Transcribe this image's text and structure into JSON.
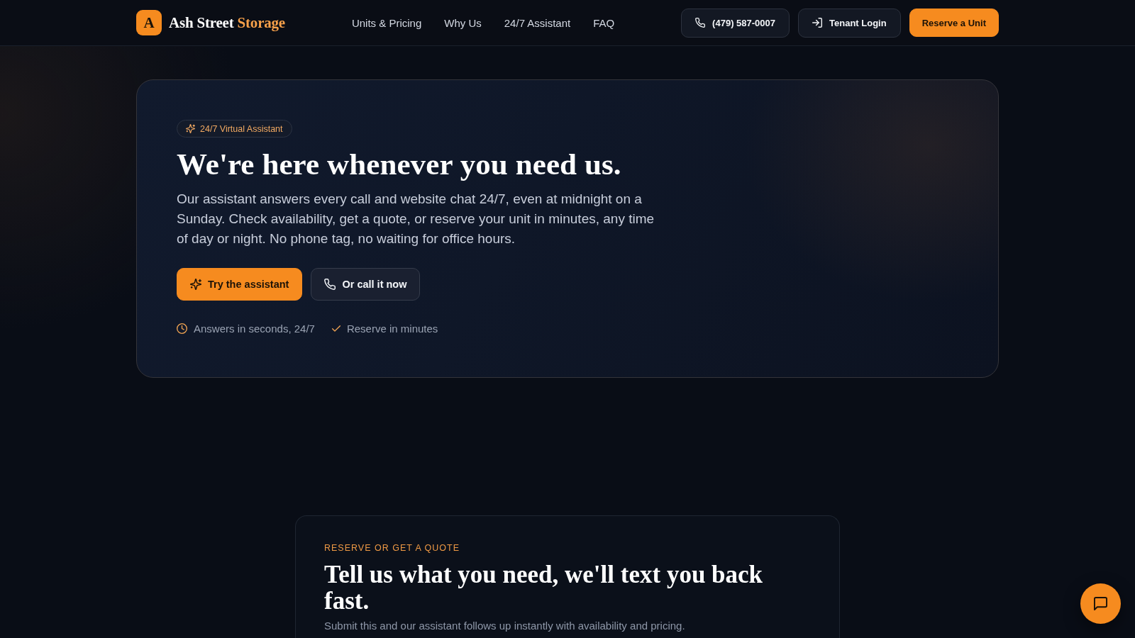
{
  "header": {
    "logo": {
      "mark": "A",
      "name": "Ash Street",
      "accent": "Storage"
    },
    "nav": [
      {
        "label": "Units & Pricing"
      },
      {
        "label": "Why Us"
      },
      {
        "label": "24/7 Assistant"
      },
      {
        "label": "FAQ"
      }
    ],
    "actions": [
      {
        "kind": "call",
        "label": "(479) 587-0007"
      },
      {
        "kind": "login",
        "label": "Tenant Login"
      },
      {
        "kind": "reserve",
        "label": "Reserve a Unit"
      }
    ]
  },
  "hero": {
    "badge": "24/7 Virtual Assistant",
    "title": "We're here whenever you need us.",
    "description": "Our assistant answers every call and website chat 24/7, even at midnight on a Sunday. Check availability, get a quote, or reserve your unit in minutes, any time of day or night. No phone tag, no waiting for office hours.",
    "buttons": [
      {
        "kind": "assistant",
        "label": "Try the assistant"
      },
      {
        "kind": "call",
        "label": "Or call it now"
      }
    ],
    "highlights": [
      {
        "kind": "time",
        "text": "Answers in seconds, 24/7"
      },
      {
        "kind": "check",
        "text": "Reserve in minutes"
      }
    ]
  },
  "quote": {
    "eyebrow": "RESERVE OR GET A QUOTE",
    "title": "Tell us what you need, we'll text you back fast.",
    "subtitle": "Submit this and our assistant follows up instantly with availability and pricing."
  },
  "chat_launcher": {
    "kind": "chat"
  }
}
